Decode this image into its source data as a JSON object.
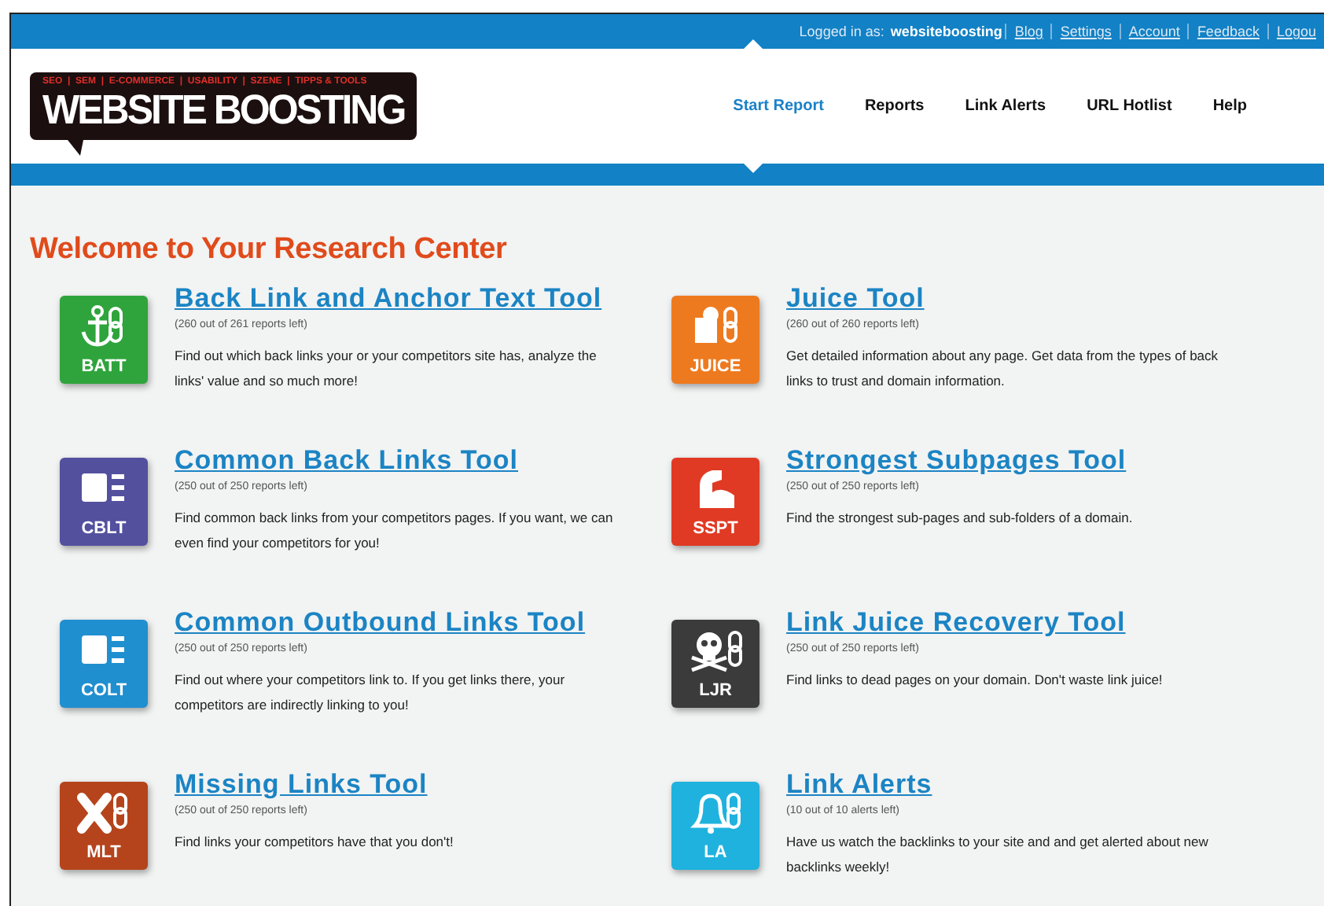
{
  "top_bar": {
    "login_label": "Logged in as:",
    "username": "websiteboosting",
    "links": [
      "Blog",
      "Settings",
      "Account",
      "Feedback",
      "Logou"
    ]
  },
  "logo": {
    "tagline": "SEO  |  SEM  |  E-COMMERCE  |  USABILITY  |  SZENE  |  TIPPS & TOOLS",
    "name": "WEBSITE BOOSTING"
  },
  "nav": [
    {
      "label": "Start Report",
      "selected": true
    },
    {
      "label": "Reports",
      "selected": false
    },
    {
      "label": "Link Alerts",
      "selected": false
    },
    {
      "label": "URL Hotlist",
      "selected": false
    },
    {
      "label": "Help",
      "selected": false
    }
  ],
  "heading": "Welcome to Your Research Center",
  "tools": [
    {
      "kind": "anchor",
      "color": "#2fa43c",
      "abbr": "BATT",
      "title": "Back Link and Anchor Text Tool",
      "quota": "(260 out of 261 reports left)",
      "description": "Find out which back links your or your competitors site has, analyze the links' value and so much more!"
    },
    {
      "kind": "juice",
      "color": "#ee7a1f",
      "abbr": "JUICE",
      "title": "Juice Tool",
      "quota": "(260 out of 260 reports left)",
      "description": "Get detailed information about any page. Get data from the types of back links to trust and domain information."
    },
    {
      "kind": "blocks",
      "color": "#53509e",
      "abbr": "CBLT",
      "title": "Common Back Links Tool",
      "quota": "(250 out of 250 reports left)",
      "description": "Find common back links from your competitors pages. If you want, we can even find your competitors for you!"
    },
    {
      "kind": "arm",
      "color": "#e03a24",
      "abbr": "SSPT",
      "title": "Strongest Subpages Tool",
      "quota": "(250 out of 250 reports left)",
      "description": "Find the strongest sub-pages and sub-folders of a domain."
    },
    {
      "kind": "blocks",
      "color": "#1f8fd0",
      "abbr": "COLT",
      "title": "Common Outbound Links Tool",
      "quota": "(250 out of 250 reports left)",
      "description": "Find out where your competitors link to. If you get links there, your competitors are indirectly linking to you!"
    },
    {
      "kind": "skull",
      "color": "#3b3b3b",
      "abbr": "LJR",
      "title": "Link Juice Recovery Tool",
      "quota": "(250 out of 250 reports left)",
      "description": "Find links to dead pages on your domain. Don't waste link juice!"
    },
    {
      "kind": "cross",
      "color": "#b5441c",
      "abbr": "MLT",
      "title": "Missing Links Tool",
      "quota": "(250 out of 250 reports left)",
      "description": "Find links your competitors have that you don't!"
    },
    {
      "kind": "bell",
      "color": "#1fb2de",
      "abbr": "LA",
      "title": "Link Alerts",
      "quota": "(10 out of 10 alerts left)",
      "description": "Have us watch the backlinks to your site and and get alerted about new backlinks weekly!"
    }
  ]
}
